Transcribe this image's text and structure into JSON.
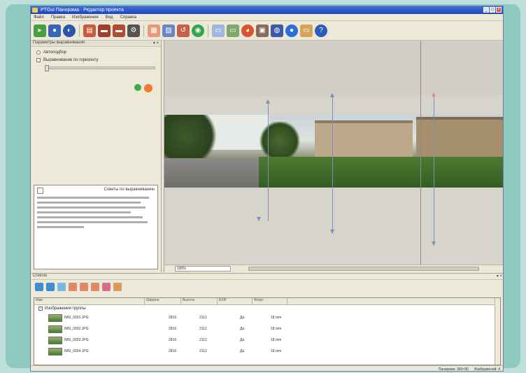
{
  "window": {
    "title": "PTGui Панорама  ·  Редактор проекта",
    "controls": [
      "_",
      "□",
      "×"
    ]
  },
  "menu": [
    "Файл",
    "Правка",
    "Изображения",
    "Вид",
    "Справка"
  ],
  "toolbar_icons": [
    "open-icon",
    "save-icon",
    "globe-icon",
    "align-icon",
    "control-points-icon",
    "optimize-icon",
    "crop-icon",
    "grid-icon",
    "mask-icon",
    "rotate-icon",
    "color-icon",
    "link-icon",
    "sphere-icon",
    "stitch-icon",
    "globe2-icon",
    "batch-icon",
    "help-icon"
  ],
  "left_panel": {
    "header": "Параметры выравнивания",
    "option1": "Автоподбор",
    "option2": "Выравнивание по горизонту",
    "info_title": "Советы по выравниванию",
    "info_lines": 7
  },
  "viewport": {
    "zoom_field": "100%"
  },
  "bottom_panel": {
    "header": "Список",
    "columns": [
      "Имя",
      "Ширина",
      "Высота",
      "EXIF",
      "Фокус"
    ],
    "group_label": "Изображения группы",
    "rows": [
      {
        "name": "IMG_0001.JPG",
        "width": "2816",
        "height": "2112",
        "exif": "Да",
        "focus": "18 mm"
      },
      {
        "name": "IMG_0002.JPG",
        "width": "2816",
        "height": "2112",
        "exif": "Да",
        "focus": "18 mm"
      },
      {
        "name": "IMG_0003.JPG",
        "width": "2816",
        "height": "2112",
        "exif": "Да",
        "focus": "18 mm"
      },
      {
        "name": "IMG_0004.JPG",
        "width": "2816",
        "height": "2112",
        "exif": "Да",
        "focus": "18 mm"
      }
    ]
  },
  "status": {
    "left": "Панорама: 360×90",
    "right": "Изображений: 4"
  }
}
